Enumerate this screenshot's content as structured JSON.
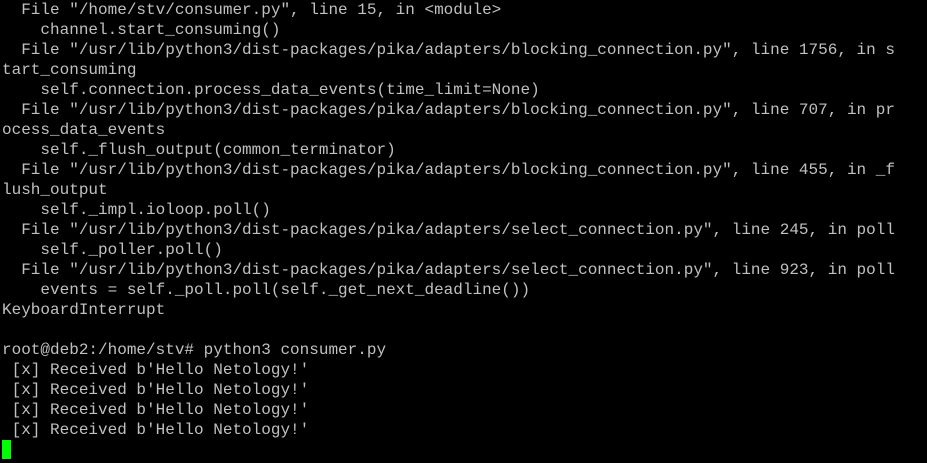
{
  "terminal": {
    "cursor_color": "#00ff00",
    "text_color": "#c0c0c0",
    "background_color": "#000000",
    "lines": [
      "  File \"/home/stv/consumer.py\", line 15, in <module>",
      "    channel.start_consuming()",
      "  File \"/usr/lib/python3/dist-packages/pika/adapters/blocking_connection.py\", line 1756, in s",
      "tart_consuming",
      "    self.connection.process_data_events(time_limit=None)",
      "  File \"/usr/lib/python3/dist-packages/pika/adapters/blocking_connection.py\", line 707, in pr",
      "ocess_data_events",
      "    self._flush_output(common_terminator)",
      "  File \"/usr/lib/python3/dist-packages/pika/adapters/blocking_connection.py\", line 455, in _f",
      "lush_output",
      "    self._impl.ioloop.poll()",
      "  File \"/usr/lib/python3/dist-packages/pika/adapters/select_connection.py\", line 245, in poll",
      "    self._poller.poll()",
      "  File \"/usr/lib/python3/dist-packages/pika/adapters/select_connection.py\", line 923, in poll",
      "    events = self._poll.poll(self._get_next_deadline())",
      "KeyboardInterrupt",
      "",
      "root@deb2:/home/stv# python3 consumer.py",
      " [x] Received b'Hello Netology!'",
      " [x] Received b'Hello Netology!'",
      " [x] Received b'Hello Netology!'",
      " [x] Received b'Hello Netology!'"
    ]
  }
}
